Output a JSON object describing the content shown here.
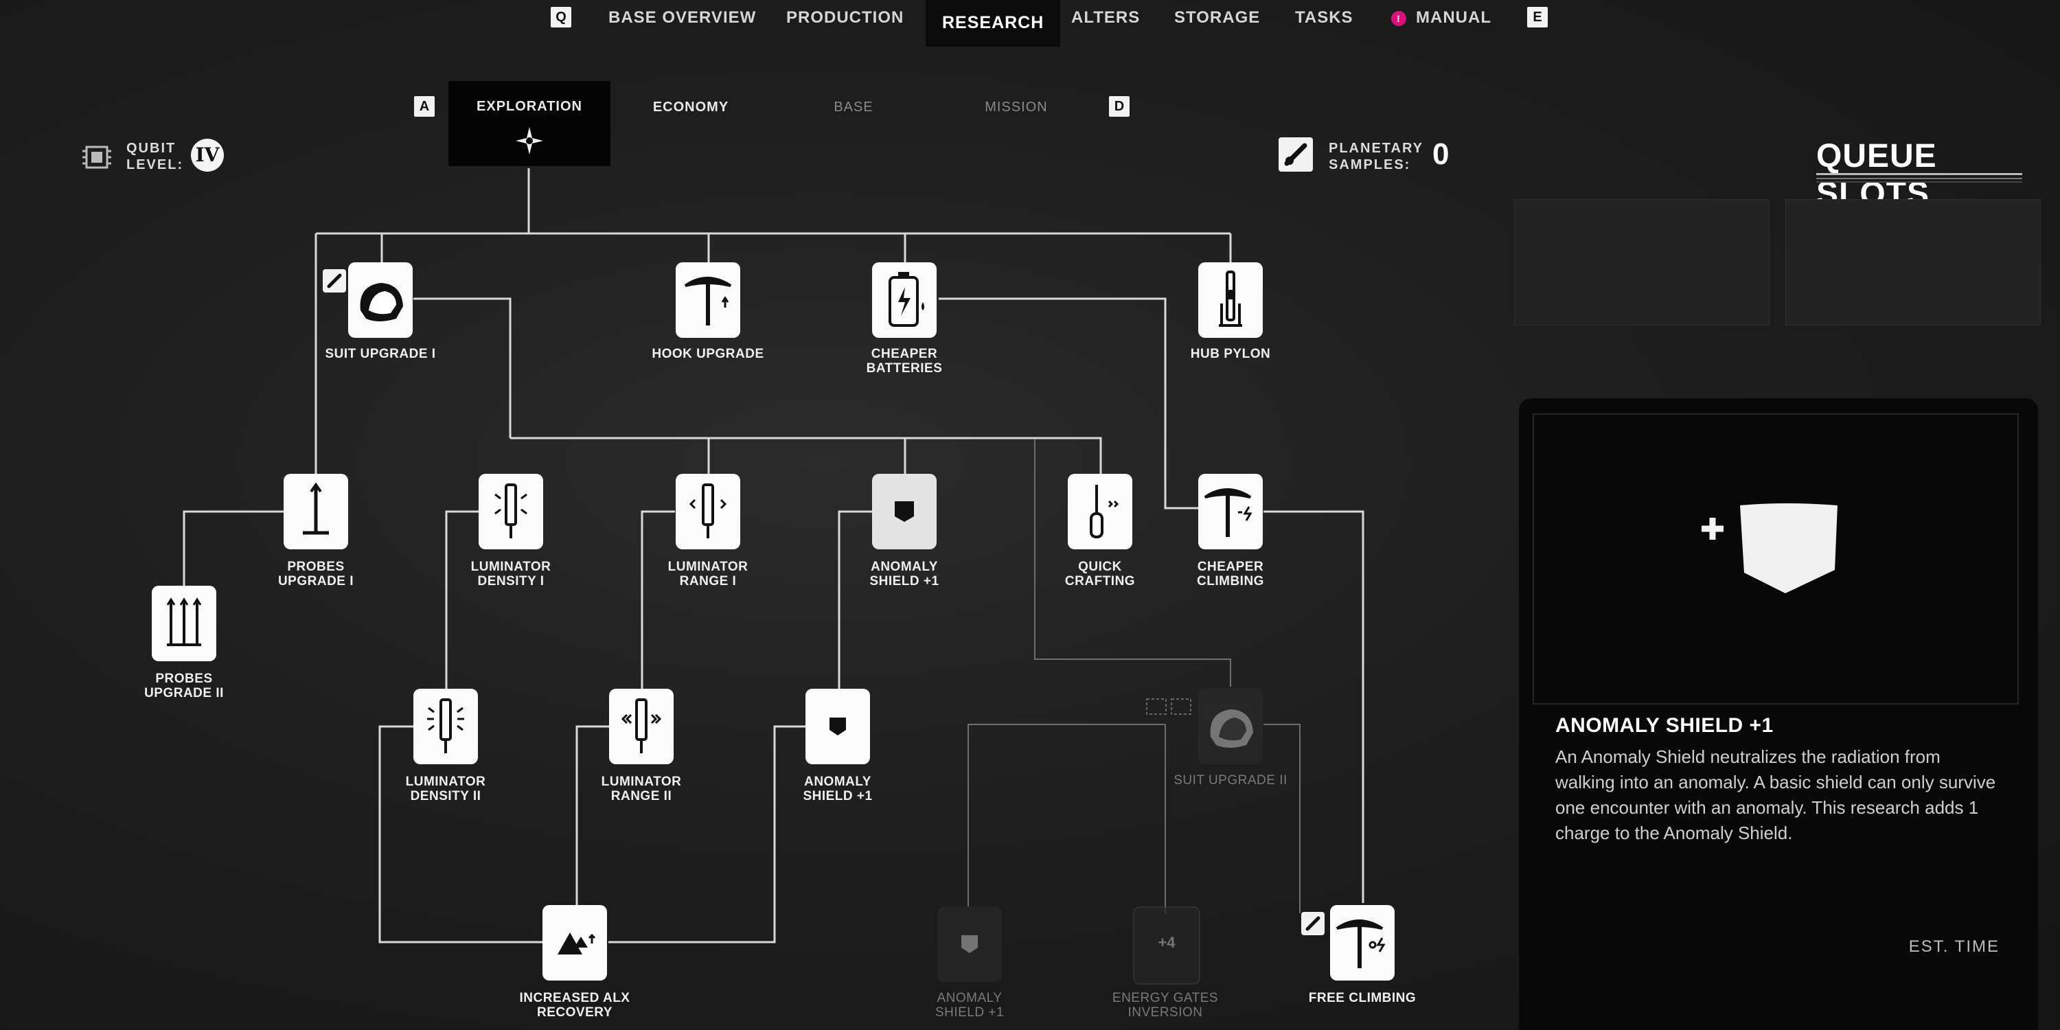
{
  "topnav": {
    "left_key": "Q",
    "right_key": "E",
    "items": [
      {
        "label": "BASE OVERVIEW"
      },
      {
        "label": "PRODUCTION"
      },
      {
        "label": "RESEARCH",
        "active": true
      },
      {
        "label": "ALTERS"
      },
      {
        "label": "STORAGE"
      },
      {
        "label": "TASKS"
      },
      {
        "label": "MANUAL",
        "badge": "!"
      }
    ]
  },
  "subtabs": {
    "left_key": "A",
    "right_key": "D",
    "items": [
      {
        "label": "EXPLORATION",
        "active": true
      },
      {
        "label": "ECONOMY"
      },
      {
        "label": "BASE"
      },
      {
        "label": "MISSION"
      }
    ]
  },
  "qubit": {
    "label_line1": "QUBIT",
    "label_line2": "LEVEL:",
    "value": "IV"
  },
  "samples": {
    "label_line1": "PLANETARY",
    "label_line2": "SAMPLES:",
    "value": "0"
  },
  "queue": {
    "title": "QUEUE SLOTS"
  },
  "nodes": {
    "suit_upgrade_1": {
      "label": "SUIT UPGRADE I"
    },
    "hook_upgrade": {
      "label": "HOOK UPGRADE"
    },
    "cheaper_batteries": {
      "l1": "CHEAPER",
      "l2": "BATTERIES"
    },
    "hub_pylon": {
      "label": "HUB PYLON"
    },
    "probes_upgrade_1": {
      "l1": "PROBES",
      "l2": "UPGRADE I"
    },
    "probes_upgrade_2": {
      "l1": "PROBES",
      "l2": "UPGRADE II"
    },
    "luminator_density_1": {
      "l1": "LUMINATOR",
      "l2": "DENSITY I"
    },
    "luminator_range_1": {
      "l1": "LUMINATOR",
      "l2": "RANGE I"
    },
    "anomaly_shield_1": {
      "l1": "ANOMALY",
      "l2": "SHIELD +1"
    },
    "quick_crafting": {
      "l1": "QUICK",
      "l2": "CRAFTING"
    },
    "cheaper_climbing": {
      "l1": "CHEAPER",
      "l2": "CLIMBING"
    },
    "luminator_density_2": {
      "l1": "LUMINATOR",
      "l2": "DENSITY II"
    },
    "luminator_range_2": {
      "l1": "LUMINATOR",
      "l2": "RANGE II"
    },
    "anomaly_shield_2": {
      "l1": "ANOMALY",
      "l2": "SHIELD +1"
    },
    "suit_upgrade_2": {
      "label": "SUIT UPGRADE II"
    },
    "increased_alx": {
      "l1": "INCREASED ALX",
      "l2": "RECOVERY"
    },
    "anomaly_shield_3": {
      "l1": "ANOMALY",
      "l2": "SHIELD +1"
    },
    "energy_gates": {
      "l1": "ENERGY GATES",
      "l2": "INVERSION",
      "icon_text": "+4"
    },
    "free_climbing": {
      "label": "FREE CLIMBING"
    }
  },
  "detail": {
    "title": "ANOMALY SHIELD +1",
    "body": "An Anomaly Shield neutralizes the radiation from walking into an anomaly. A basic shield can only survive one encounter with an anomaly. This research adds 1 charge to the Anomaly Shield.",
    "est_time": "EST. TIME"
  }
}
